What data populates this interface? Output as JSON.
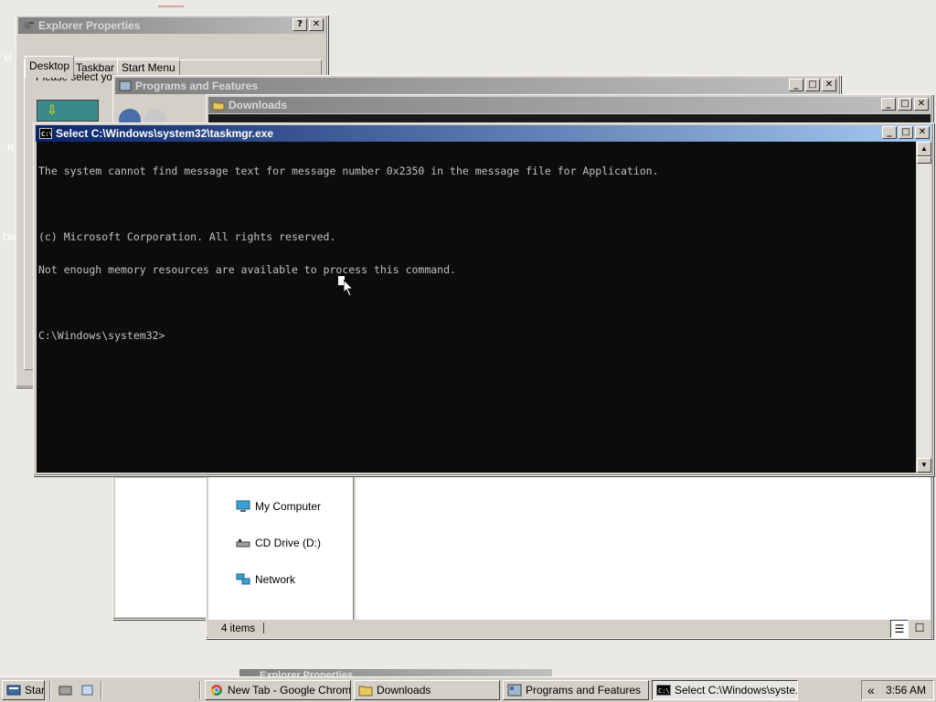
{
  "explorer_props": {
    "title": "Explorer Properties",
    "tabs": [
      "Desktop",
      "Taskbar",
      "Start Menu"
    ],
    "body_text": "Please select you",
    "help_btn": "?",
    "close_btn": "✕"
  },
  "programs": {
    "title": "Programs and Features"
  },
  "downloads": {
    "title": "Downloads",
    "nav": [
      "My Computer",
      "CD Drive (D:)",
      "Network"
    ],
    "status": "4 items"
  },
  "cmd": {
    "title": "Select C:\\Windows\\system32\\taskmgr.exe",
    "lines": [
      "The system cannot find message text for message number 0x2350 in the message file for Application.",
      "",
      "(c) Microsoft Corporation. All rights reserved.",
      "Not enough memory resources are available to process this command.",
      "",
      "C:\\Windows\\system32>"
    ]
  },
  "desktop_fragments": [
    "M",
    "R",
    "Da"
  ],
  "bottom_peek_title": "Explorer Properties",
  "taskbar": {
    "start": "Start",
    "items": [
      {
        "label": "New Tab - Google Chrome",
        "icon": "chrome-icon"
      },
      {
        "label": "Downloads",
        "icon": "folder-icon"
      },
      {
        "label": "Programs and Features",
        "icon": "programs-icon"
      },
      {
        "label": "Select C:\\Windows\\syste...",
        "icon": "cmd-icon"
      }
    ],
    "tray_arrow": "«",
    "clock": "3:56 AM"
  },
  "colors": {
    "active_title": "#0a246a",
    "inactive_title": "#808080",
    "console_bg": "#0c0c0c",
    "console_fg": "#c0c0c0"
  }
}
